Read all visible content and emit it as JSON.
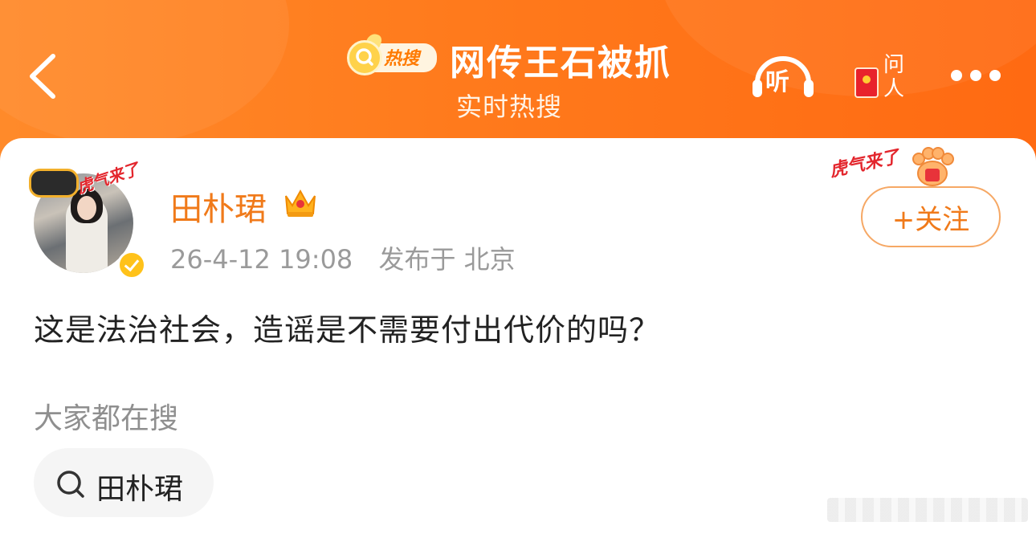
{
  "header": {
    "badge_text": "热搜",
    "title": "网传王石被抓",
    "subtitle": "实时热搜",
    "listen_label": "听",
    "ask_label_top": "问",
    "ask_label_bottom": "人"
  },
  "post": {
    "author": "田朴珺",
    "timestamp": "26-4-12 19:08",
    "location": "发布于 北京",
    "follow_label": "+关注",
    "avatar_frame_text": "虎气来了",
    "follow_decor_text": "虎气来了",
    "body": "这是法治社会，造谣是不需要付出代价的吗？"
  },
  "related": {
    "label": "大家都在搜",
    "chips": [
      "田朴珺"
    ]
  },
  "colors": {
    "header_orange": "#ff7a1c",
    "username_orange": "#f07a1a",
    "follow_border": "#f6a865",
    "verified_gold": "#ffc21a"
  }
}
